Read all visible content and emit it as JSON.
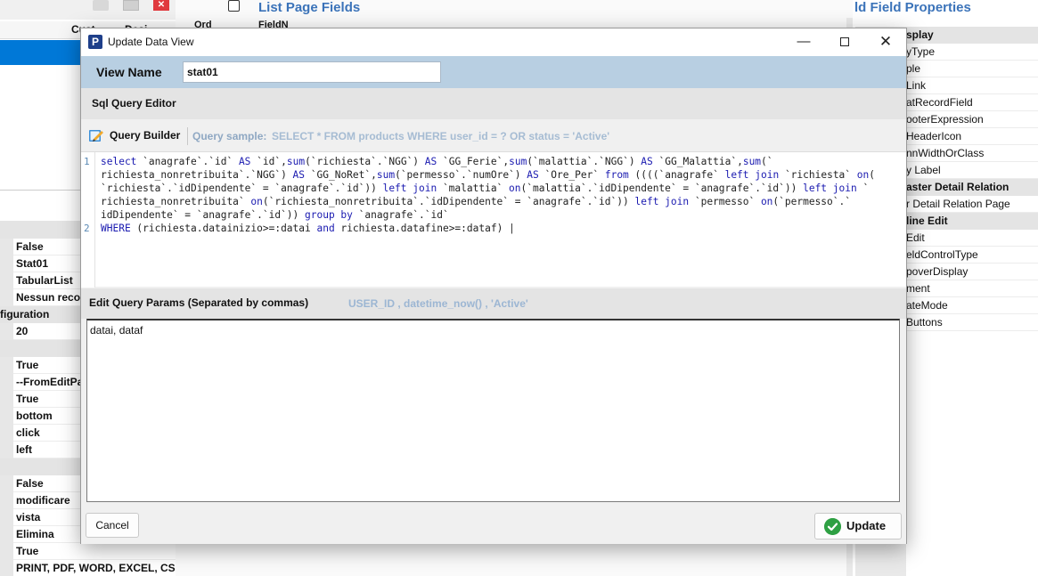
{
  "background": {
    "left_header": [
      "Cust",
      "Desi"
    ],
    "properties": [
      {
        "value": "False"
      },
      {
        "value": "Stat01"
      },
      {
        "value": "TabularList"
      },
      {
        "value": "Nessun reco"
      },
      {
        "category": "figuration"
      },
      {
        "value": "20"
      },
      {
        "category": ""
      },
      {
        "value": "True"
      },
      {
        "value": "--FromEditPa"
      },
      {
        "value": "True"
      },
      {
        "value": "bottom"
      },
      {
        "value": "click"
      },
      {
        "value": "left"
      },
      {
        "category": ""
      },
      {
        "value": "False"
      },
      {
        "value": "modificare"
      },
      {
        "value": "vista"
      },
      {
        "value": "Elimina"
      },
      {
        "value": "True"
      },
      {
        "value": "PRINT, PDF, WORD, EXCEL, CS"
      }
    ],
    "middle_title": "List Page Fields",
    "middle_cols": [
      "Ord",
      "FieldN"
    ],
    "right_title": "ld Field Properties",
    "right_rows": [
      {
        "category": "splay"
      },
      {
        "text": "yType"
      },
      {
        "text": "ple"
      },
      {
        "text": "Link"
      },
      {
        "text": "atRecordField"
      },
      {
        "text": "ooterExpression"
      },
      {
        "text": "HeaderIcon"
      },
      {
        "text": "nnWidthOrClass"
      },
      {
        "text": "y Label"
      },
      {
        "category": "aster Detail Relation"
      },
      {
        "text": "r Detail Relation Page"
      },
      {
        "category": "line Edit"
      },
      {
        "text": "Edit"
      },
      {
        "text": "eldControlType"
      },
      {
        "text": "poverDisplay"
      },
      {
        "text": "ment"
      },
      {
        "text": "ateMode"
      },
      {
        "text": "Buttons"
      }
    ]
  },
  "dialog": {
    "title": "Update Data View",
    "app_icon": "P",
    "window_buttons": {
      "minimize": "—",
      "close": "✕"
    },
    "view_name_label": "View Name",
    "view_name_value": "stat01",
    "sql_editor_label": "Sql Query Editor",
    "query_builder_label": "Query Builder",
    "query_sample_label": "Query sample:",
    "query_sample_value": "SELECT * FROM products WHERE user_id = ? OR  status = 'Active'",
    "line_numbers": [
      "1",
      "2"
    ],
    "params_label": "Edit Query Params (Separated by commas)",
    "params_sample": "USER_ID , datetime_now() , 'Active'",
    "params_value": "datai, dataf",
    "cancel_label": "Cancel",
    "update_label": "Update",
    "update_icon": "check-circle-icon",
    "accent_color": "#b8cfe2",
    "success_color": "#2ea043"
  },
  "sql_query": {
    "text": "select `anagrafe`.`id` AS `id`,sum(`richiesta`.`NGG`) AS `GG_Ferie`,sum(`malattia`.`NGG`) AS `GG_Malattia`,sum(`richiesta_nonretribuita`.`NGG`) AS `GG_NoRet`,sum(`permesso`.`numOre`) AS `Ore_Per` from ((((`anagrafe` left join `richiesta` on(`richiesta`.`idDipendente` = `anagrafe`.`id`)) left join `malattia` on(`malattia`.`idDipendente` = `anagrafe`.`id`)) left join `richiesta_nonretribuita` on(`richiesta_nonretribuita`.`idDipendente` = `anagrafe`.`id`)) left join `permesso` on(`permesso`.`idDipendente` = `anagrafe`.`id`)) group by `anagrafe`.`id`\nWHERE (richiesta.datainizio>=:datai and richiesta.datafine>=:dataf)",
    "display_rows": [
      {
        "line": 1,
        "segments": [
          {
            "t": "select ",
            "kw": true
          },
          {
            "t": "`anagrafe`.`id` ",
            "kw": false
          },
          {
            "t": "AS",
            "kw": true
          },
          {
            "t": " `id`,",
            "kw": false
          },
          {
            "t": "sum",
            "kw": true
          },
          {
            "t": "(`richiesta`.`NGG`) ",
            "kw": false
          },
          {
            "t": "AS",
            "kw": true
          },
          {
            "t": " `GG_Ferie`,",
            "kw": false
          },
          {
            "t": "sum",
            "kw": true
          },
          {
            "t": "(`malattia`.`NGG`) ",
            "kw": false
          },
          {
            "t": "AS",
            "kw": true
          },
          {
            "t": " `GG_Malattia`,",
            "kw": false
          },
          {
            "t": "sum",
            "kw": true
          },
          {
            "t": "(`",
            "kw": false
          }
        ]
      },
      {
        "line": null,
        "segments": [
          {
            "t": "richiesta_nonretribuita`.`NGG`) ",
            "kw": false
          },
          {
            "t": "AS",
            "kw": true
          },
          {
            "t": " `GG_NoRet`,",
            "kw": false
          },
          {
            "t": "sum",
            "kw": true
          },
          {
            "t": "(`permesso`.`numOre`) ",
            "kw": false
          },
          {
            "t": "AS",
            "kw": true
          },
          {
            "t": " `Ore_Per` ",
            "kw": false
          },
          {
            "t": "from",
            "kw": true
          },
          {
            "t": " ((((`anagrafe` ",
            "kw": false
          },
          {
            "t": "left join",
            "kw": true
          },
          {
            "t": " `richiesta` ",
            "kw": false
          },
          {
            "t": "on",
            "kw": true
          },
          {
            "t": "(",
            "kw": false
          }
        ]
      },
      {
        "line": null,
        "segments": [
          {
            "t": "`richiesta`.`idDipendente` = `anagrafe`.`id`)) ",
            "kw": false
          },
          {
            "t": "left join",
            "kw": true
          },
          {
            "t": " `malattia` ",
            "kw": false
          },
          {
            "t": "on",
            "kw": true
          },
          {
            "t": "(`malattia`.`idDipendente` = `anagrafe`.`id`)) ",
            "kw": false
          },
          {
            "t": "left join",
            "kw": true
          },
          {
            "t": " `",
            "kw": false
          }
        ]
      },
      {
        "line": null,
        "segments": [
          {
            "t": "richiesta_nonretribuita` ",
            "kw": false
          },
          {
            "t": "on",
            "kw": true
          },
          {
            "t": "(`richiesta_nonretribuita`.`idDipendente` = `anagrafe`.`id`)) ",
            "kw": false
          },
          {
            "t": "left join",
            "kw": true
          },
          {
            "t": " `permesso` ",
            "kw": false
          },
          {
            "t": "on",
            "kw": true
          },
          {
            "t": "(`permesso`.`",
            "kw": false
          }
        ]
      },
      {
        "line": null,
        "segments": [
          {
            "t": "idDipendente` = `anagrafe`.`id`)) ",
            "kw": false
          },
          {
            "t": "group by",
            "kw": true
          },
          {
            "t": " `anagrafe`.`id`",
            "kw": false
          }
        ]
      },
      {
        "line": 2,
        "segments": [
          {
            "t": "WHERE",
            "kw": true
          },
          {
            "t": " (richiesta.datainizio>=:datai ",
            "kw": false
          },
          {
            "t": "and",
            "kw": true
          },
          {
            "t": " richiesta.datafine>=:dataf) |",
            "kw": false
          }
        ]
      }
    ]
  }
}
